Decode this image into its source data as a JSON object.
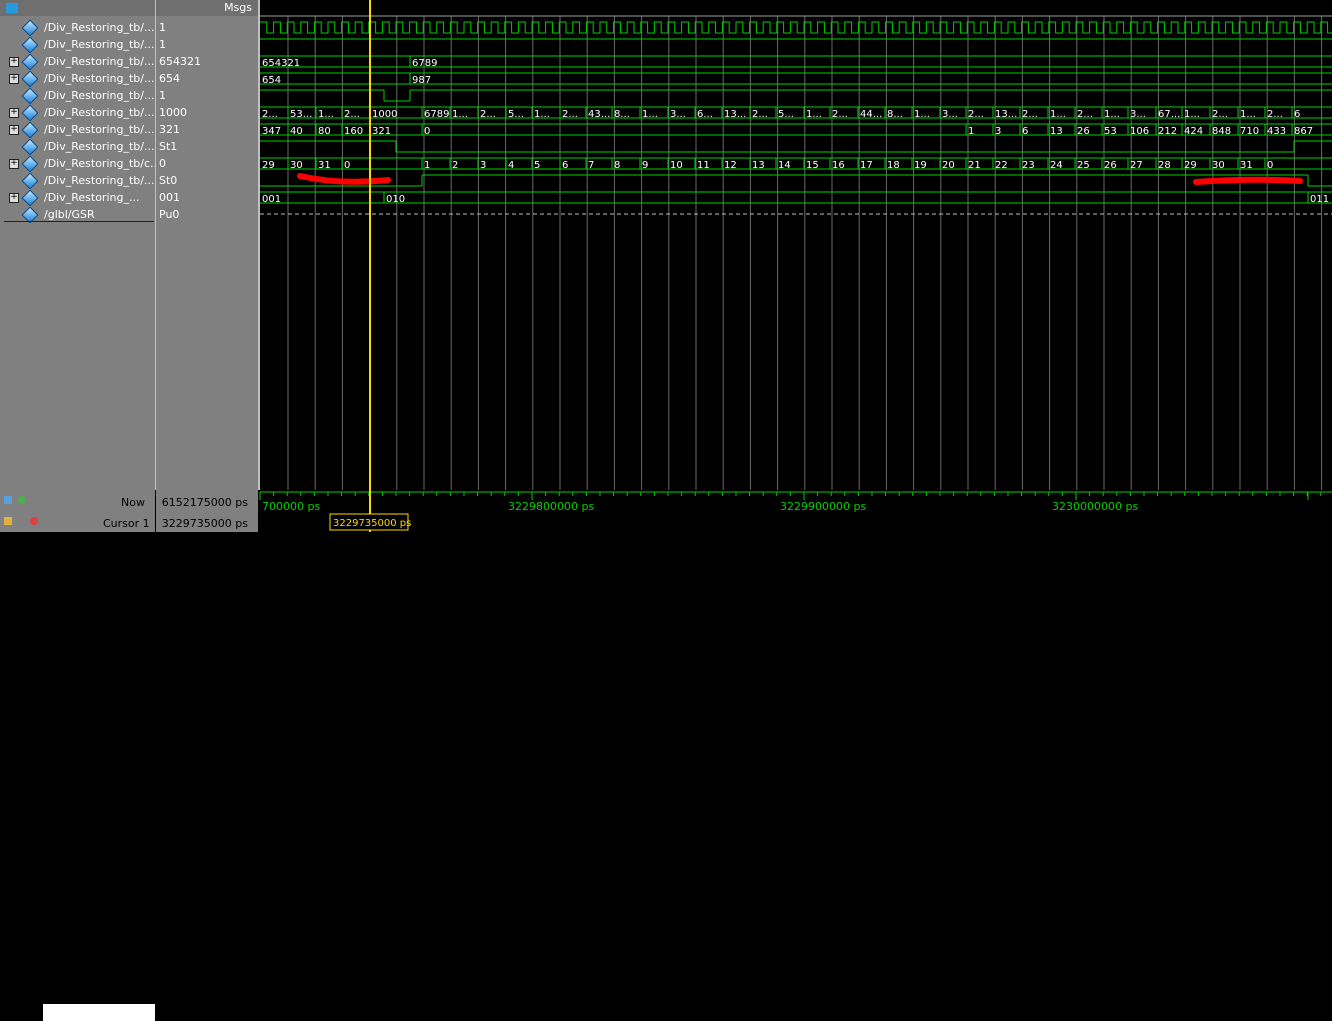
{
  "header": {
    "msgs_label": "Msgs"
  },
  "signals": [
    {
      "name": "/Div_Restoring_tb/...",
      "value": "1",
      "expand": false,
      "icon": "diamond-icon"
    },
    {
      "name": "/Div_Restoring_tb/...",
      "value": "1",
      "expand": false,
      "icon": "diamond-icon"
    },
    {
      "name": "/Div_Restoring_tb/...",
      "value": "654321",
      "expand": true,
      "icon": "diamond-icon"
    },
    {
      "name": "/Div_Restoring_tb/...",
      "value": "654",
      "expand": true,
      "icon": "diamond-icon"
    },
    {
      "name": "/Div_Restoring_tb/...",
      "value": "1",
      "expand": false,
      "icon": "diamond-icon"
    },
    {
      "name": "/Div_Restoring_tb/...",
      "value": "1000",
      "expand": true,
      "icon": "diamond-icon"
    },
    {
      "name": "/Div_Restoring_tb/...",
      "value": "321",
      "expand": true,
      "icon": "diamond-icon"
    },
    {
      "name": "/Div_Restoring_tb/...",
      "value": "St1",
      "expand": false,
      "icon": "diamond-icon"
    },
    {
      "name": "/Div_Restoring_tb/c...",
      "value": "0",
      "expand": true,
      "icon": "diamond-icon"
    },
    {
      "name": "/Div_Restoring_tb/...",
      "value": "St0",
      "expand": false,
      "icon": "diamond-icon"
    },
    {
      "name": "/Div_Restoring_...",
      "value": "001",
      "expand": true,
      "icon": "state-icon"
    },
    {
      "name": "/glbl/GSR",
      "value": "Pu0",
      "expand": false,
      "icon": "diamond-icon"
    }
  ],
  "waves": {
    "row2": [
      [
        "654321",
        0
      ],
      [
        "6789",
        150
      ]
    ],
    "row3": [
      [
        "654",
        0
      ],
      [
        "987",
        150
      ]
    ],
    "row5": [
      [
        "2...",
        0
      ],
      [
        "53...",
        28
      ],
      [
        "1...",
        56
      ],
      [
        "2...",
        82
      ],
      [
        "1000",
        110
      ],
      [
        "6789",
        162
      ],
      [
        "1...",
        190
      ],
      [
        "2...",
        218
      ],
      [
        "5...",
        246
      ],
      [
        "1...",
        272
      ],
      [
        "2...",
        300
      ],
      [
        "43...",
        326
      ],
      [
        "8...",
        352
      ],
      [
        "1...",
        380
      ],
      [
        "3...",
        408
      ],
      [
        "6...",
        435
      ],
      [
        "13...",
        462
      ],
      [
        "2...",
        490
      ],
      [
        "5...",
        516
      ],
      [
        "1...",
        544
      ],
      [
        "2...",
        570
      ],
      [
        "44...",
        598
      ],
      [
        "8...",
        625
      ],
      [
        "1...",
        652
      ],
      [
        "3...",
        680
      ],
      [
        "2...",
        706
      ],
      [
        "13...",
        733
      ],
      [
        "2...",
        760
      ],
      [
        "1...",
        788
      ],
      [
        "2...",
        815
      ],
      [
        "1...",
        842
      ],
      [
        "3...",
        868
      ],
      [
        "67...",
        896
      ],
      [
        "1...",
        922
      ],
      [
        "2...",
        950
      ],
      [
        "1...",
        978
      ],
      [
        "2...",
        1005
      ],
      [
        "6",
        1032
      ]
    ],
    "row6": [
      [
        "347",
        0
      ],
      [
        "40",
        28
      ],
      [
        "80",
        56
      ],
      [
        "160",
        82
      ],
      [
        "321",
        110
      ],
      [
        "0",
        162
      ],
      [
        "1",
        706
      ],
      [
        "3",
        733
      ],
      [
        "6",
        760
      ],
      [
        "13",
        788
      ],
      [
        "26",
        815
      ],
      [
        "53",
        842
      ],
      [
        "106",
        868
      ],
      [
        "212",
        896
      ],
      [
        "424",
        922
      ],
      [
        "848",
        950
      ],
      [
        "710",
        978
      ],
      [
        "433",
        1005
      ],
      [
        "867",
        1032
      ]
    ],
    "row8": [
      [
        "29",
        0
      ],
      [
        "30",
        28
      ],
      [
        "31",
        56
      ],
      [
        "0",
        82
      ],
      [
        "1",
        162
      ],
      [
        "2",
        190
      ],
      [
        "3",
        218
      ],
      [
        "4",
        246
      ],
      [
        "5",
        272
      ],
      [
        "6",
        300
      ],
      [
        "7",
        326
      ],
      [
        "8",
        352
      ],
      [
        "9",
        380
      ],
      [
        "10",
        408
      ],
      [
        "11",
        435
      ],
      [
        "12",
        462
      ],
      [
        "13",
        490
      ],
      [
        "14",
        516
      ],
      [
        "15",
        544
      ],
      [
        "16",
        570
      ],
      [
        "17",
        598
      ],
      [
        "18",
        625
      ],
      [
        "19",
        652
      ],
      [
        "20",
        680
      ],
      [
        "21",
        706
      ],
      [
        "22",
        733
      ],
      [
        "23",
        760
      ],
      [
        "24",
        788
      ],
      [
        "25",
        815
      ],
      [
        "26",
        842
      ],
      [
        "27",
        868
      ],
      [
        "28",
        896
      ],
      [
        "29",
        922
      ],
      [
        "30",
        950
      ],
      [
        "31",
        978
      ],
      [
        "0",
        1005
      ]
    ],
    "row10": [
      [
        "001",
        0
      ],
      [
        "010",
        124
      ],
      [
        "011",
        1048
      ]
    ]
  },
  "bottom": {
    "now_label": "Now",
    "now_value": "6152175000 ps",
    "cursor_label": "Cursor 1",
    "cursor_value": "3229735000 ps",
    "cursor_tag": "3229735000 ps",
    "time_labels": [
      {
        "text": "700000 ps",
        "t": 0
      },
      {
        "text": "3229800000 ps",
        "t": 0.5
      },
      {
        "text": "3229900000 ps",
        "t": 0.75
      },
      {
        "text": "3230000000 ps",
        "t": 1.0
      }
    ]
  },
  "colors": {
    "wave": "#00d000",
    "cursor": "#ffd700",
    "grid": "#6a6a6a",
    "annotation": "#ff0000"
  }
}
